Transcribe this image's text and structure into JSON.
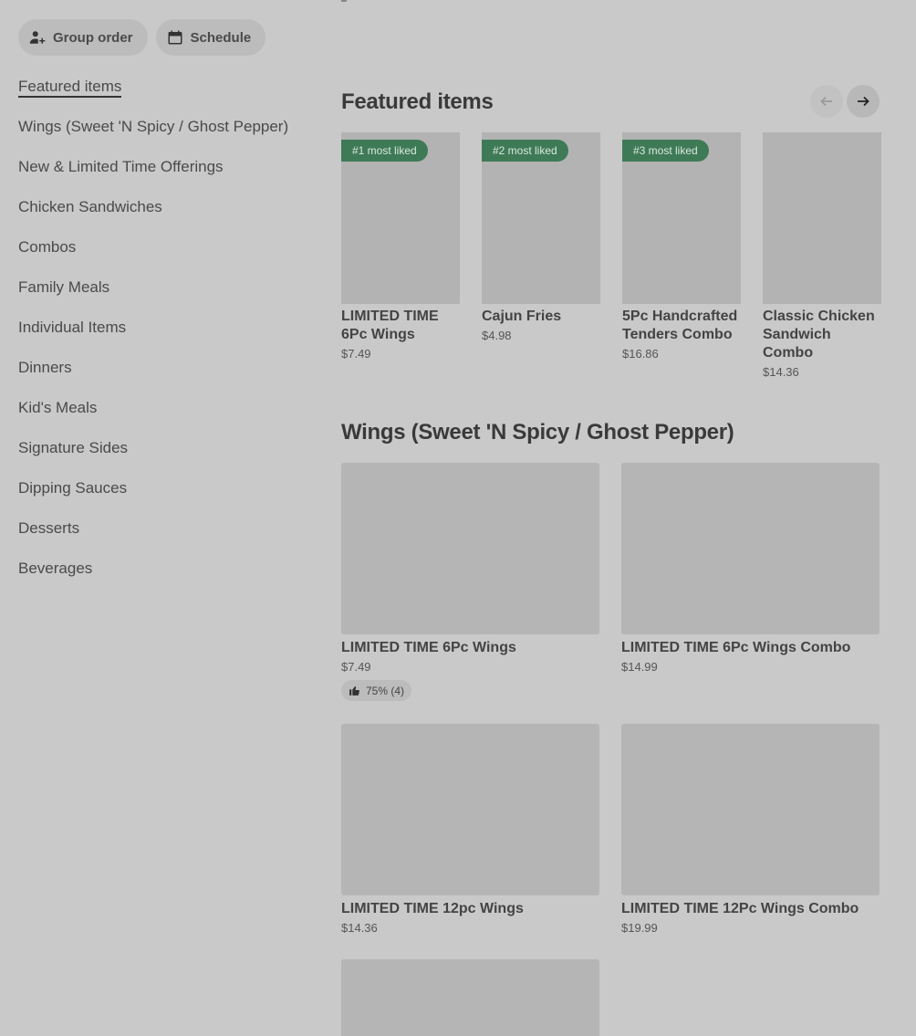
{
  "toolbar": {
    "group_order": "Group order",
    "schedule": "Schedule"
  },
  "sidebar": {
    "items": [
      "Featured items",
      "Wings (Sweet 'N Spicy / Ghost Pepper)",
      "New & Limited Time Offerings",
      "Chicken Sandwiches",
      "Combos",
      "Family Meals",
      "Individual Items",
      "Dinners",
      "Kid's Meals",
      "Signature Sides",
      "Dipping Sauces",
      "Desserts",
      "Beverages"
    ]
  },
  "featured": {
    "title": "Featured items",
    "cards": [
      {
        "badge": "#1 most liked",
        "name": "LIMITED TIME 6Pc Wings",
        "price": "$7.49"
      },
      {
        "badge": "#2 most liked",
        "name": "Cajun Fries",
        "price": "$4.98"
      },
      {
        "badge": "#3 most liked",
        "name": "5Pc Handcrafted Tenders Combo",
        "price": "$16.86"
      },
      {
        "badge": "",
        "name": "Classic Chicken Sandwich Combo",
        "price": "$14.36"
      }
    ]
  },
  "wings": {
    "title": "Wings (Sweet 'N Spicy / Ghost Pepper)",
    "items": [
      {
        "name": "LIMITED TIME 6Pc Wings",
        "price": "$7.49",
        "rating": "75% (4)"
      },
      {
        "name": "LIMITED TIME 6Pc Wings Combo",
        "price": "$14.99",
        "rating": ""
      },
      {
        "name": "LIMITED TIME 12pc Wings",
        "price": "$14.36",
        "rating": ""
      },
      {
        "name": "LIMITED TIME 12Pc Wings Combo",
        "price": "$19.99",
        "rating": ""
      }
    ]
  },
  "colors": {
    "background": "#c9c9c9",
    "badge": "#3f7a57"
  }
}
